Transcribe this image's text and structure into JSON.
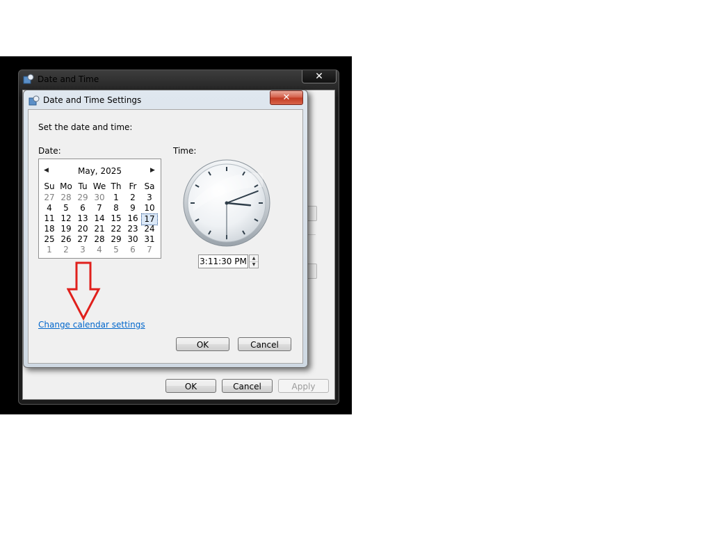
{
  "outer_window": {
    "title": "Date and Time",
    "close_glyph": "✕",
    "buttons": {
      "ok": "OK",
      "cancel": "Cancel",
      "apply": "Apply"
    },
    "apply_enabled": false
  },
  "dialog": {
    "title": "Date and Time Settings",
    "close_glyph": "✕",
    "instruction": "Set the date and time:",
    "date_label": "Date:",
    "time_label": "Time:",
    "calendar": {
      "month_year": "May, 2025",
      "prev_glyph": "◀",
      "next_glyph": "▶",
      "weekdays": [
        "Su",
        "Mo",
        "Tu",
        "We",
        "Th",
        "Fr",
        "Sa"
      ],
      "weeks": [
        [
          "27",
          "28",
          "29",
          "30",
          "1",
          "2",
          "3"
        ],
        [
          "4",
          "5",
          "6",
          "7",
          "8",
          "9",
          "10"
        ],
        [
          "11",
          "12",
          "13",
          "14",
          "15",
          "16",
          "17"
        ],
        [
          "18",
          "19",
          "20",
          "21",
          "22",
          "23",
          "24"
        ],
        [
          "25",
          "26",
          "27",
          "28",
          "29",
          "30",
          "31"
        ],
        [
          "1",
          "2",
          "3",
          "4",
          "5",
          "6",
          "7"
        ]
      ],
      "selected_day": "17"
    },
    "time_value": "3:11:30 PM",
    "change_calendar_link": "Change calendar settings",
    "ok_label": "OK",
    "cancel_label": "Cancel"
  },
  "annotation": {
    "icon": "red-down-arrow-icon",
    "color": "#e0201c"
  },
  "colors": {
    "link": "#0066cc",
    "close_red": "#c13a22"
  }
}
